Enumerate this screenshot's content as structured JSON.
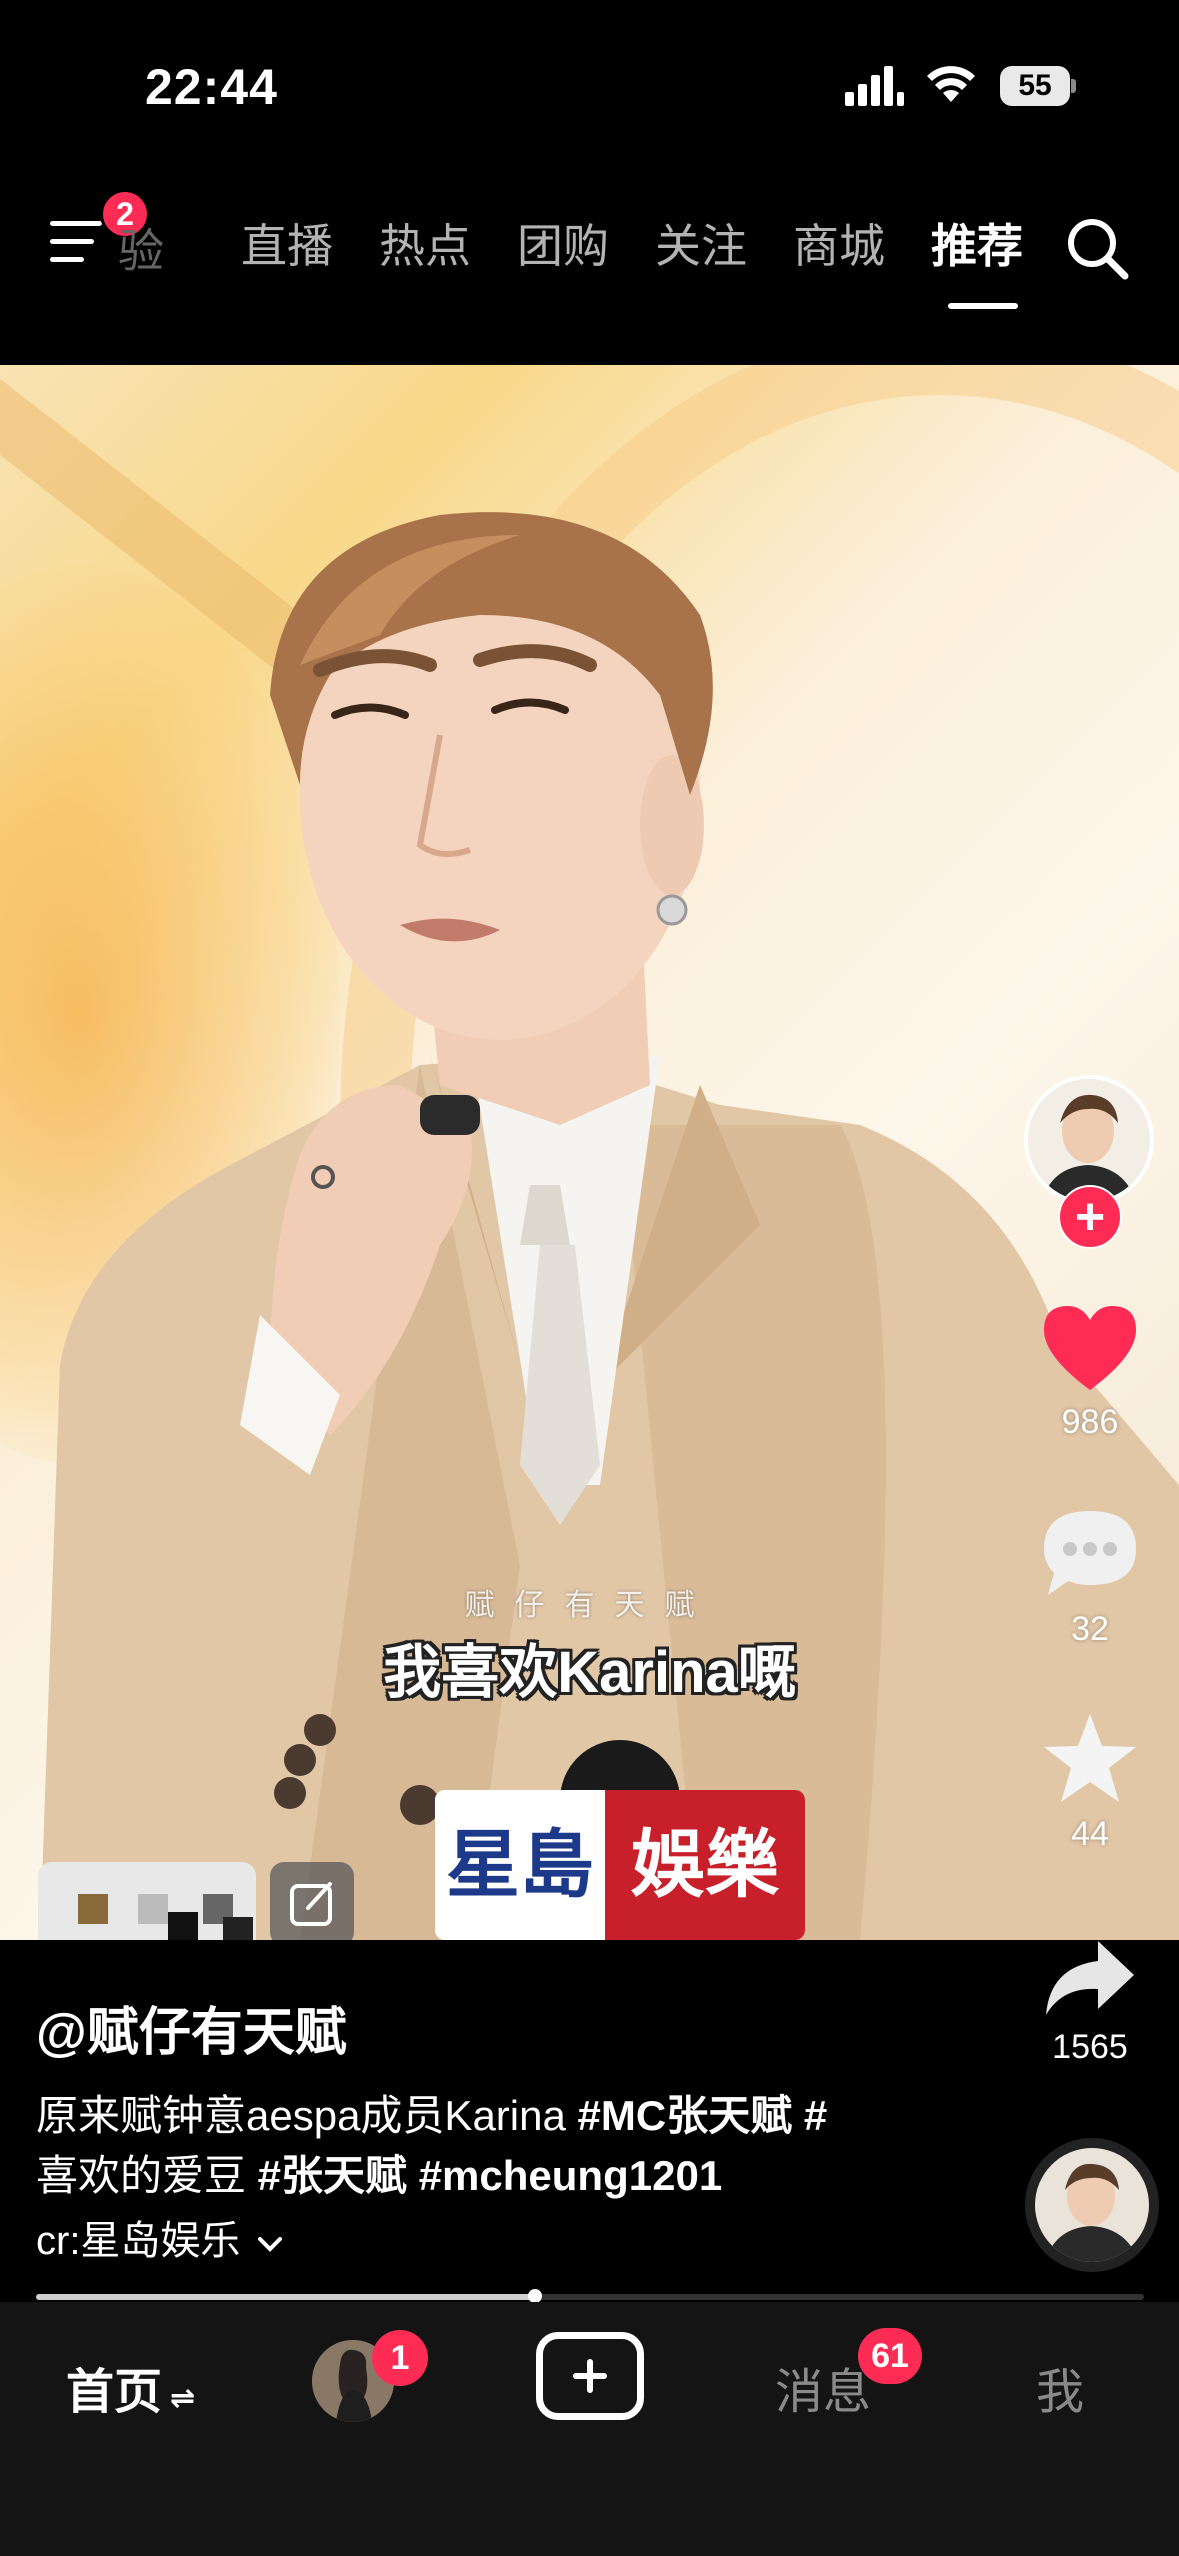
{
  "status_bar": {
    "time": "22:44",
    "battery": "55"
  },
  "top_nav": {
    "menu_badge": "2",
    "partial_tab": "验",
    "tabs": [
      {
        "label": "直播"
      },
      {
        "label": "热点"
      },
      {
        "label": "团购"
      },
      {
        "label": "关注"
      },
      {
        "label": "商城"
      },
      {
        "label": "推荐"
      }
    ],
    "active_tab": "推荐"
  },
  "video": {
    "small_subtitle": "赋仔有天赋",
    "subtitle": "我喜欢Karina嘅",
    "mic_flag_left": "星島",
    "mic_flag_right": "娛樂"
  },
  "rail": {
    "likes": "986",
    "comments": "32",
    "favorites": "44",
    "shares": "1565"
  },
  "post": {
    "author": "@赋仔有天赋",
    "caption_text": "原来赋钟意aespa成员Karina ",
    "caption_tag1": "#MC张天赋",
    "caption_tag2": " #",
    "caption_line2_text": "喜欢的爱豆 ",
    "caption_tag3": "#张天赋",
    "caption_tag4": " #mcheung1201",
    "credit": "cr:星岛娱乐",
    "progress_percent": 45
  },
  "bottom_bar": {
    "home": "首页",
    "home_swap": "⇌",
    "friend_badge": "1",
    "messages": "消息",
    "messages_badge": "61",
    "me": "我"
  },
  "colors": {
    "accent": "#fe2c55",
    "background": "#000000"
  }
}
